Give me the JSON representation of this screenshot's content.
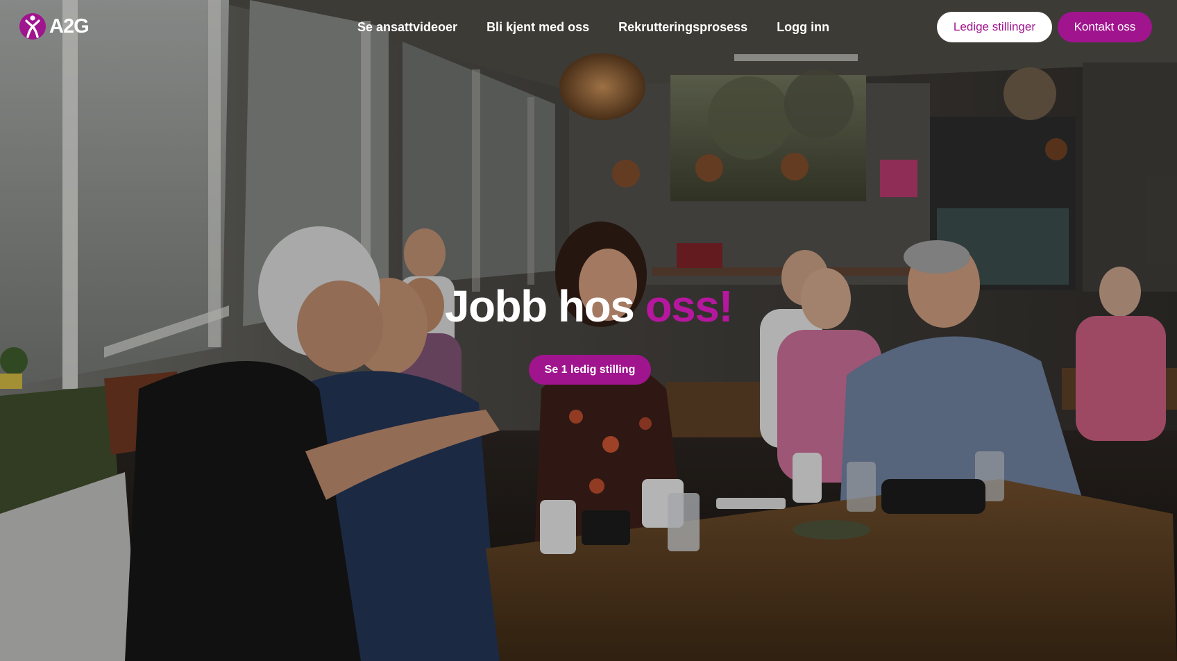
{
  "brand": {
    "logo_text": "A2G",
    "accent_color": "#a0148e"
  },
  "nav": {
    "links": [
      {
        "label": "Se ansattvideoer"
      },
      {
        "label": "Bli kjent med oss"
      },
      {
        "label": "Rekrutteringsprosess"
      },
      {
        "label": "Logg inn"
      }
    ],
    "vacancies_button": "Ledige stillinger",
    "contact_button": "Kontakt oss"
  },
  "hero": {
    "headline_main": "Jobb hos ",
    "headline_accent": "oss!",
    "cta_label": "Se 1 ledig stilling"
  }
}
